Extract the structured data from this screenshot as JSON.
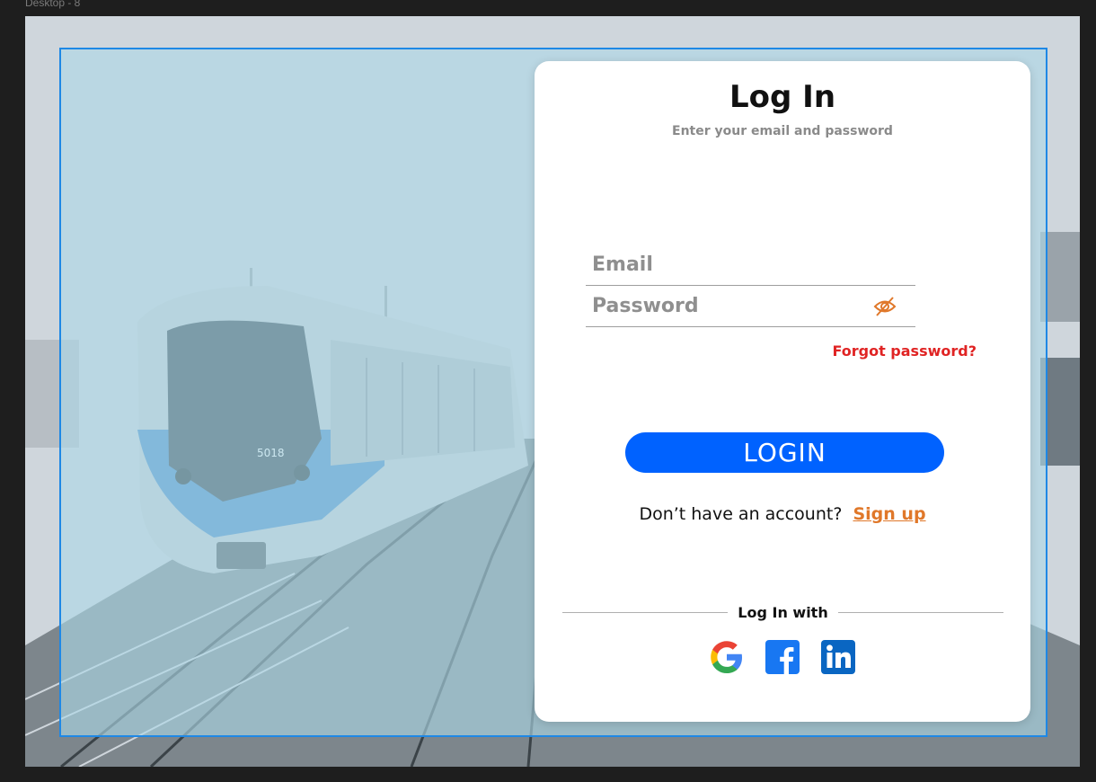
{
  "frame": {
    "label": "Desktop - 8"
  },
  "train": {
    "number": "5018"
  },
  "card": {
    "title": "Log In",
    "subtitle": "Enter your email and password",
    "email_placeholder": "Email",
    "password_placeholder": "Password",
    "forgot_label": "Forgot password?",
    "login_label": "LOGIN",
    "signup_prompt": "Don’t have an account?",
    "signup_label": "Sign up",
    "social_label": "Log In with"
  },
  "social": [
    {
      "name": "google-icon",
      "color": "#4285F4"
    },
    {
      "name": "facebook-icon",
      "color": "#1877F2"
    },
    {
      "name": "linkedin-icon",
      "color": "#0A66C2"
    }
  ],
  "colors": {
    "accent": "#0062ff",
    "forgot": "#e02424",
    "signup": "#e0782a",
    "overlay_border": "#1e88e5"
  }
}
